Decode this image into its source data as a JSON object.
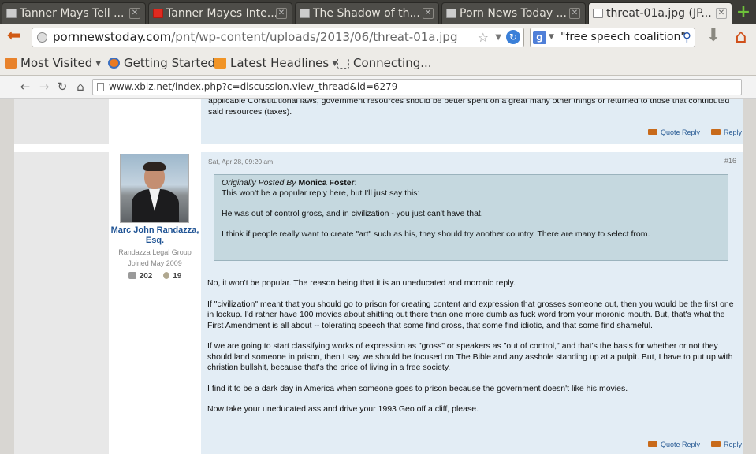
{
  "tabs": [
    {
      "label": "Tanner Mays Tell ...",
      "icon": "generic"
    },
    {
      "label": "Tanner Mayes Inte...",
      "icon": "youtube"
    },
    {
      "label": "The Shadow of th...",
      "icon": "generic"
    },
    {
      "label": "Porn News Today ...",
      "icon": "generic"
    },
    {
      "label": "threat-01a.jpg (JP...",
      "icon": "blank"
    }
  ],
  "nav": {
    "url_host": "pornnewstoday.com",
    "url_path": "/pnt/wp-content/uploads/2013/06/threat-01a.jpg",
    "search_value": "\"free speech coalition\""
  },
  "bookmarks": [
    {
      "label": "Most Visited",
      "has_caret": true
    },
    {
      "label": "Getting Started",
      "has_caret": false
    },
    {
      "label": "Latest Headlines",
      "has_caret": true
    },
    {
      "label": "Connecting...",
      "has_caret": false
    }
  ],
  "inner_url": "www.xbiz.net/index.php?c=discussion.view_thread&id=6279",
  "prev_post": {
    "text": "applicable Constitutional laws, government resources should be better spent on a great many other things or returned to those that contributed said resources (taxes).",
    "quote_reply": "Quote Reply",
    "reply": "Reply"
  },
  "post": {
    "date": "Sat, Apr 28, 09:20 am",
    "number": "#16",
    "user": {
      "name": "Marc John Randazza, Esq.",
      "title": "Randazza Legal Group",
      "joined": "Joined May 2009",
      "posts": "202",
      "medals": "19"
    },
    "quote": {
      "prefix": "Originally Posted By",
      "author": "Monica Foster",
      "colon": ":",
      "lines": [
        "This won't be a popular reply here, but I'll just say this:",
        "He was out of control gross, and in civilization - you just can't have that.",
        "I think if people really want to create \"art\" such as his, they should try another country. There are many to select from."
      ]
    },
    "paragraphs": [
      "No, it won't be popular.  The reason being that it is an uneducated and moronic reply.",
      "If \"civilization\" meant that you should go to prison for creating content and expression that grosses someone out, then you would be the first one in lockup.  I'd rather have 100 movies about shitting out there than one more dumb as fuck word from your moronic mouth.  But, that's what the First Amendment is all about -- tolerating speech that some find gross, that some find idiotic, and that some find shameful.",
      "If we are going to start classifying works of expression as \"gross\" or speakers as \"out of control,\" and that's the basis for whether or not they should land someone in prison, then I say we should be focused on The Bible and any asshole standing up at a pulpit.  But, I have to put up with christian bullshit, because that's the price of living in a free society.",
      "I find it to be a dark day in America when someone goes to prison because the government doesn't like his movies.",
      "Now take your uneducated ass and drive your 1993 Geo off a cliff, please."
    ],
    "quote_reply": "Quote Reply",
    "reply": "Reply"
  }
}
